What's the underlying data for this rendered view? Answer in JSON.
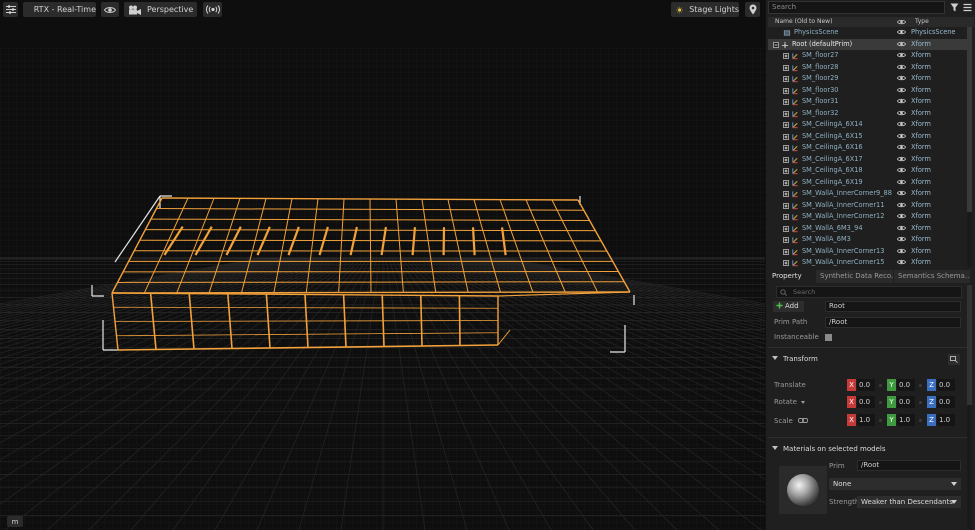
{
  "viewport": {
    "toolbar": {
      "renderer_label": "RTX - Real-Time",
      "camera_label": "Perspective",
      "lights_label": "Stage Lights"
    },
    "bottom_badge": "m"
  },
  "stage": {
    "search_placeholder": "Search",
    "columns": {
      "name": "Name (Old to New)",
      "type": "Type"
    },
    "items": [
      {
        "name": "PhysicsScene",
        "type": "PhysicsScene"
      },
      {
        "name": "Root (defaultPrim)",
        "type": "Xform",
        "selected": true
      },
      {
        "name": "SM_floor27",
        "type": "Xform"
      },
      {
        "name": "SM_floor28",
        "type": "Xform"
      },
      {
        "name": "SM_floor29",
        "type": "Xform"
      },
      {
        "name": "SM_floor30",
        "type": "Xform"
      },
      {
        "name": "SM_floor31",
        "type": "Xform"
      },
      {
        "name": "SM_floor32",
        "type": "Xform"
      },
      {
        "name": "SM_CeilingA_6X14",
        "type": "Xform"
      },
      {
        "name": "SM_CeilingA_6X15",
        "type": "Xform"
      },
      {
        "name": "SM_CeilingA_6X16",
        "type": "Xform"
      },
      {
        "name": "SM_CeilingA_6X17",
        "type": "Xform"
      },
      {
        "name": "SM_CeilingA_6X18",
        "type": "Xform"
      },
      {
        "name": "SM_CeilingA_6X19",
        "type": "Xform"
      },
      {
        "name": "SM_WallA_InnerCorner9_88",
        "type": "Xform"
      },
      {
        "name": "SM_WallA_InnerCorner11",
        "type": "Xform"
      },
      {
        "name": "SM_WallA_InnerCorner12",
        "type": "Xform"
      },
      {
        "name": "SM_WallA_6M3_94",
        "type": "Xform"
      },
      {
        "name": "SM_WallA_6M3",
        "type": "Xform"
      },
      {
        "name": "SM_WallA_InnerCorner13",
        "type": "Xform"
      },
      {
        "name": "SM_WallA_InnerCorner15",
        "type": "Xform"
      }
    ]
  },
  "property": {
    "tabs": [
      "Property",
      "Synthetic Data Reco...",
      "Semantics Schema..."
    ],
    "search_placeholder": "Search",
    "add_label": "Add",
    "name_value": "Root",
    "prim_path_label": "Prim Path",
    "prim_path_value": "/Root",
    "instanceable_label": "Instanceable",
    "transform": {
      "title": "Transform",
      "translate_label": "Translate",
      "rotate_label": "Rotate",
      "scale_label": "Scale",
      "translate": [
        "0.0",
        "0.0",
        "0.0"
      ],
      "rotate": [
        "0.0",
        "0.0",
        "0.0"
      ],
      "scale": [
        "1.0",
        "1.0",
        "1.0"
      ]
    },
    "materials": {
      "title": "Materials on selected models",
      "prim_label": "Prim",
      "prim_value": "/Root",
      "material_value": "None",
      "strength_label": "Strength",
      "strength_value": "Weaker than Descendants"
    }
  },
  "axis_labels": [
    "X",
    "Y",
    "Z"
  ],
  "colors": {
    "wireframe": "#f2a13b",
    "bbox": "#e6e6e6",
    "x_axis": "#c63a3a",
    "y_axis": "#3f9a3f",
    "z_axis": "#3a6ec0"
  }
}
